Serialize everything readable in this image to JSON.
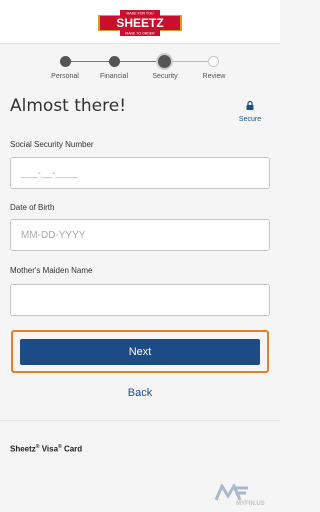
{
  "header": {
    "logo": {
      "name": "SHEETZ",
      "top_text": "MADE FOR YOU",
      "bottom_text": "MADE TO ORDER"
    }
  },
  "progress": {
    "steps": [
      {
        "label": "Personal",
        "state": "done"
      },
      {
        "label": "Financial",
        "state": "done"
      },
      {
        "label": "Security",
        "state": "current"
      },
      {
        "label": "Review",
        "state": "todo"
      }
    ]
  },
  "page": {
    "title": "Almost there!",
    "secure_label": "Secure"
  },
  "form": {
    "ssn": {
      "label": "Social Security Number",
      "placeholder": "___-__-____"
    },
    "dob": {
      "label": "Date of Birth",
      "placeholder": "MM-DD-YYYY"
    },
    "maiden": {
      "label": "Mother's Maiden Name",
      "placeholder": ""
    }
  },
  "actions": {
    "next_label": "Next",
    "back_label": "Back"
  },
  "footer": {
    "card_name_part1": "Sheetz",
    "card_name_reg1": "®",
    "card_name_part2": " Visa",
    "card_name_reg2": "®",
    "card_name_part3": " Card"
  },
  "watermark": {
    "text": "MYFIN.US"
  },
  "colors": {
    "accent": "#1c4b86",
    "focus_outline": "#ee7a2a",
    "logo_red": "#c8102e",
    "logo_gold": "#d4a017"
  }
}
